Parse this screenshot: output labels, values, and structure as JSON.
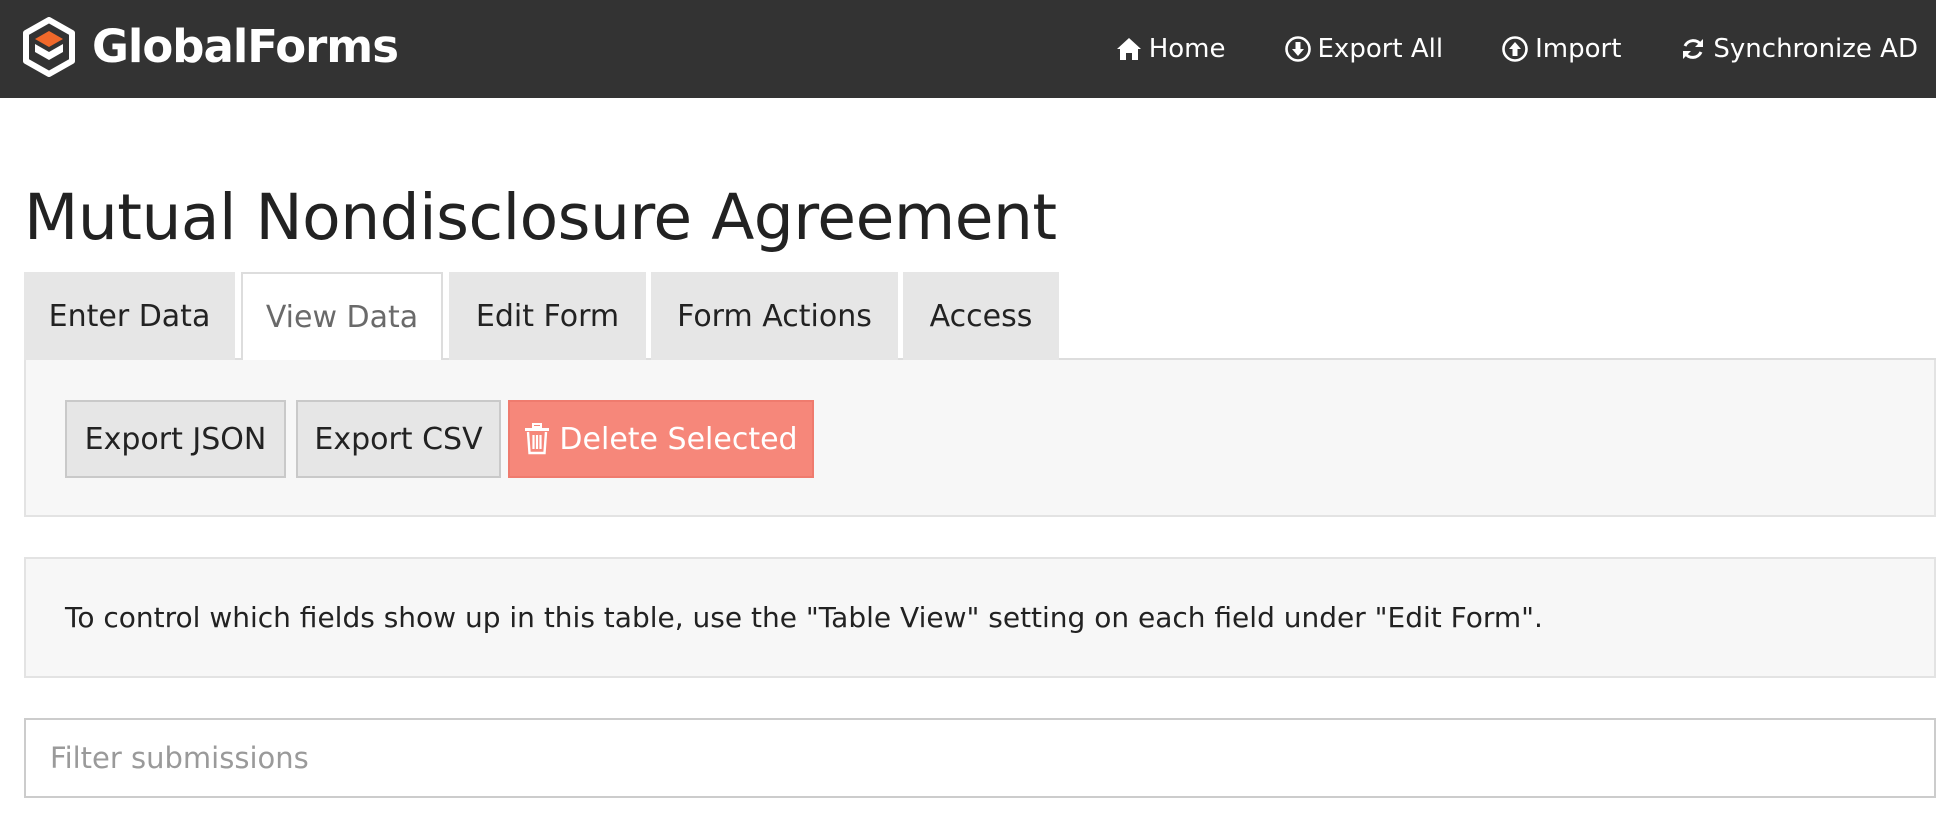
{
  "navbar": {
    "brand": "GlobalForms",
    "links": [
      {
        "label": "Home",
        "icon": "home-icon"
      },
      {
        "label": "Export All",
        "icon": "download-circle-icon"
      },
      {
        "label": "Import",
        "icon": "upload-circle-icon"
      },
      {
        "label": "Synchronize AD",
        "icon": "refresh-icon"
      }
    ]
  },
  "page": {
    "title": "Mutual Nondisclosure Agreement"
  },
  "tabs": [
    {
      "label": "Enter Data",
      "active": false
    },
    {
      "label": "View Data",
      "active": true
    },
    {
      "label": "Edit Form",
      "active": false
    },
    {
      "label": "Form Actions",
      "active": false
    },
    {
      "label": "Access",
      "active": false
    }
  ],
  "actions": {
    "export_json": "Export JSON",
    "export_csv": "Export CSV",
    "delete_selected": "Delete Selected"
  },
  "info": {
    "text": "To control which fields show up in this table, use the \"Table View\" setting on each field under \"Edit Form\"."
  },
  "filter": {
    "placeholder": "Filter submissions",
    "value": ""
  },
  "colors": {
    "navbar": "#333333",
    "logo_orange": "#f0682a",
    "danger": "#f6877a",
    "tab_inactive": "#e6e6e6",
    "panel": "#f7f7f7"
  }
}
